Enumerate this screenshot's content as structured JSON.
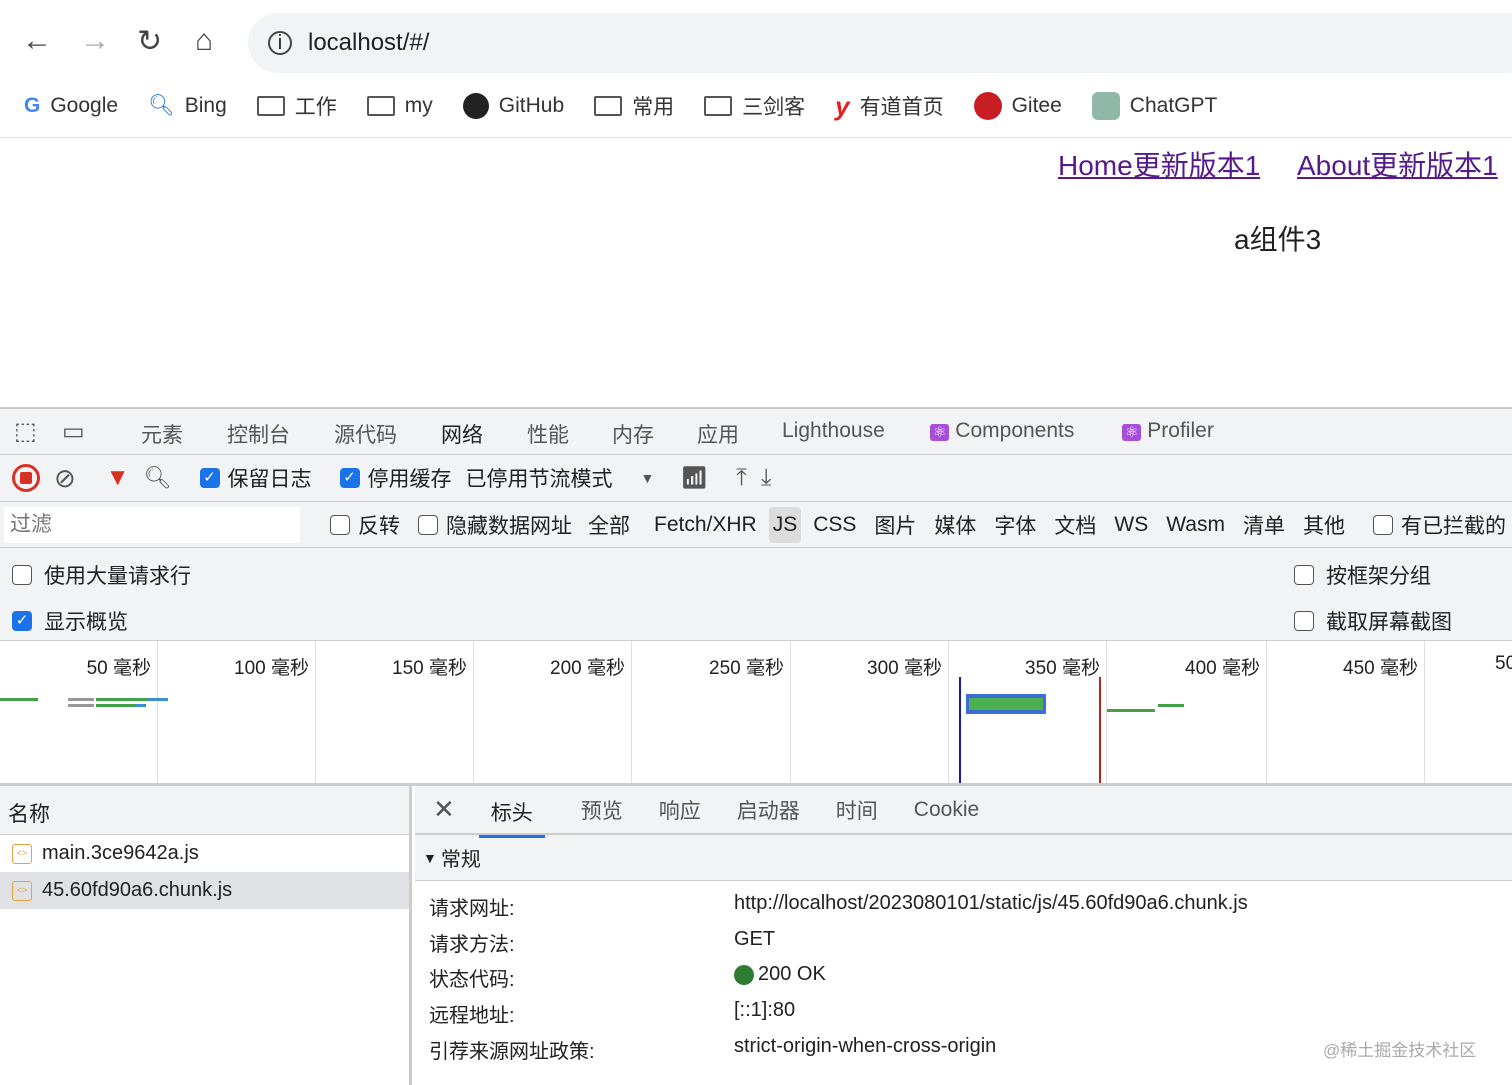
{
  "browser": {
    "url": "localhost/#/",
    "bookmarks": [
      "Google",
      "Bing",
      "工作",
      "my",
      "GitHub",
      "常用",
      "三剑客",
      "有道首页",
      "Gitee",
      "ChatGPT"
    ]
  },
  "page": {
    "links": [
      "Home更新版本1",
      "About更新版本1"
    ],
    "text": "a组件3"
  },
  "devtools": {
    "tabs": [
      "元素",
      "控制台",
      "源代码",
      "网络",
      "性能",
      "内存",
      "应用",
      "Lighthouse",
      "Components",
      "Profiler"
    ],
    "active_tab": "网络",
    "toolbar": {
      "preserve_log": "保留日志",
      "disable_cache": "停用缓存",
      "throttle": "已停用节流模式"
    },
    "filter": {
      "placeholder": "过滤",
      "invert": "反转",
      "hide_data_urls": "隐藏数据网址",
      "types": [
        "全部",
        "Fetch/XHR",
        "JS",
        "CSS",
        "图片",
        "媒体",
        "字体",
        "文档",
        "WS",
        "Wasm",
        "清单",
        "其他"
      ],
      "active_type": "JS",
      "blocked": "有已拦截的"
    },
    "options": {
      "big_rows": "使用大量请求行",
      "overview": "显示概览",
      "group_by_frame": "按框架分组",
      "screenshots": "截取屏幕截图"
    },
    "timeline_ticks": [
      "50 毫秒",
      "100 毫秒",
      "150 毫秒",
      "200 毫秒",
      "250 毫秒",
      "300 毫秒",
      "350 毫秒",
      "400 毫秒",
      "450 毫秒",
      "50"
    ],
    "requests": {
      "header": "名称",
      "files": [
        "main.3ce9642a.js",
        "45.60fd90a6.chunk.js"
      ]
    },
    "detail_tabs": [
      "标头",
      "预览",
      "响应",
      "启动器",
      "时间",
      "Cookie"
    ],
    "section": "常规",
    "general": [
      {
        "k": "请求网址:",
        "v": "http://localhost/2023080101/static/js/45.60fd90a6.chunk.js"
      },
      {
        "k": "请求方法:",
        "v": "GET"
      },
      {
        "k": "状态代码:",
        "v": "200 OK"
      },
      {
        "k": "远程地址:",
        "v": "[::1]:80"
      },
      {
        "k": "引荐来源网址政策:",
        "v": "strict-origin-when-cross-origin"
      }
    ],
    "watermark": "@稀土掘金技术社区"
  }
}
